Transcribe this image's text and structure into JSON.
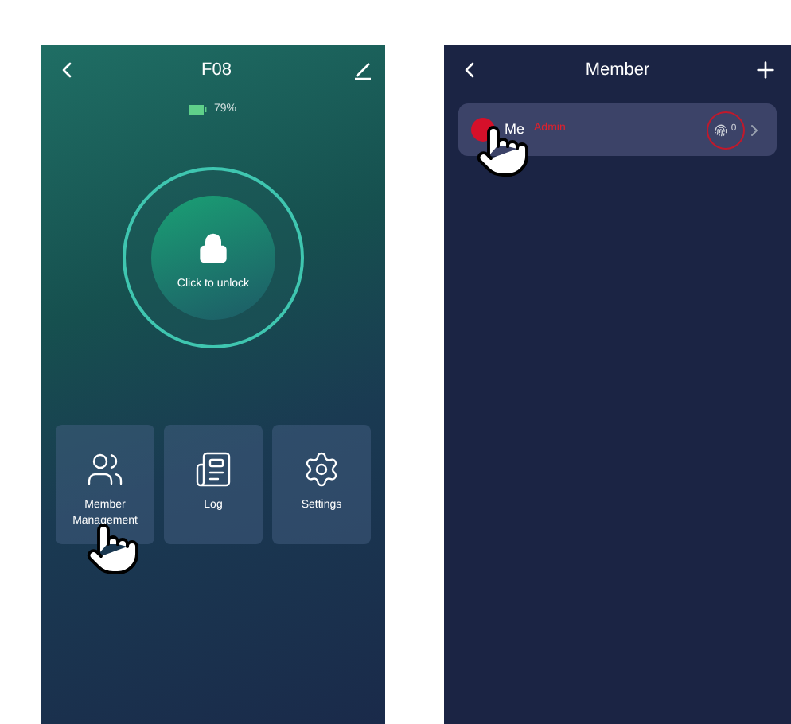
{
  "home": {
    "title": "F08",
    "battery": "79%",
    "unlock_label": "Click to unlock",
    "tiles": [
      {
        "kind": "members",
        "label": "Member Management"
      },
      {
        "kind": "log",
        "label": "Log"
      },
      {
        "kind": "settings",
        "label": "Settings"
      }
    ]
  },
  "member": {
    "title": "Member",
    "members": [
      {
        "name": "Me",
        "role": "Admin",
        "count": "0"
      }
    ]
  }
}
